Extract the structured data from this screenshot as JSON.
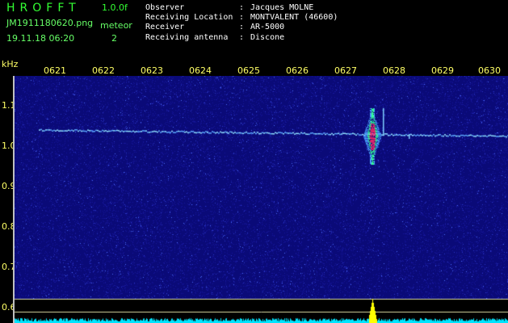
{
  "header": {
    "app_name": "HROFFT",
    "version": "1.0.0f",
    "filename": "JM1911180620.png",
    "datetime": "19.11.18 06:20",
    "detect_label": "meteor",
    "detect_count": "2"
  },
  "info": [
    {
      "key": "Observer",
      "value": "Jacques MOLNE"
    },
    {
      "key": "Receiving Location",
      "value": "MONTVALENT (46600)"
    },
    {
      "key": "Receiver",
      "value": "AR-5000"
    },
    {
      "key": "Receiving antenna",
      "value": "Discone"
    }
  ],
  "axis": {
    "unit": "kHz",
    "time_ticks": [
      "0621",
      "0622",
      "0623",
      "0624",
      "0625",
      "0626",
      "0627",
      "0628",
      "0629",
      "0630"
    ],
    "freq_ticks": [
      "1.1",
      "1.0",
      "0.9",
      "0.8",
      "0.7",
      "0.6"
    ]
  },
  "colors": {
    "background": "#000000",
    "spectrogram_bg": "#0a0a78",
    "accent_green": "#33ff33",
    "label_yellow": "#ffff66",
    "trace_cyan": "#00e5ff",
    "meteor_red": "#ff2a6a",
    "peak_yellow": "#ffff00"
  }
}
